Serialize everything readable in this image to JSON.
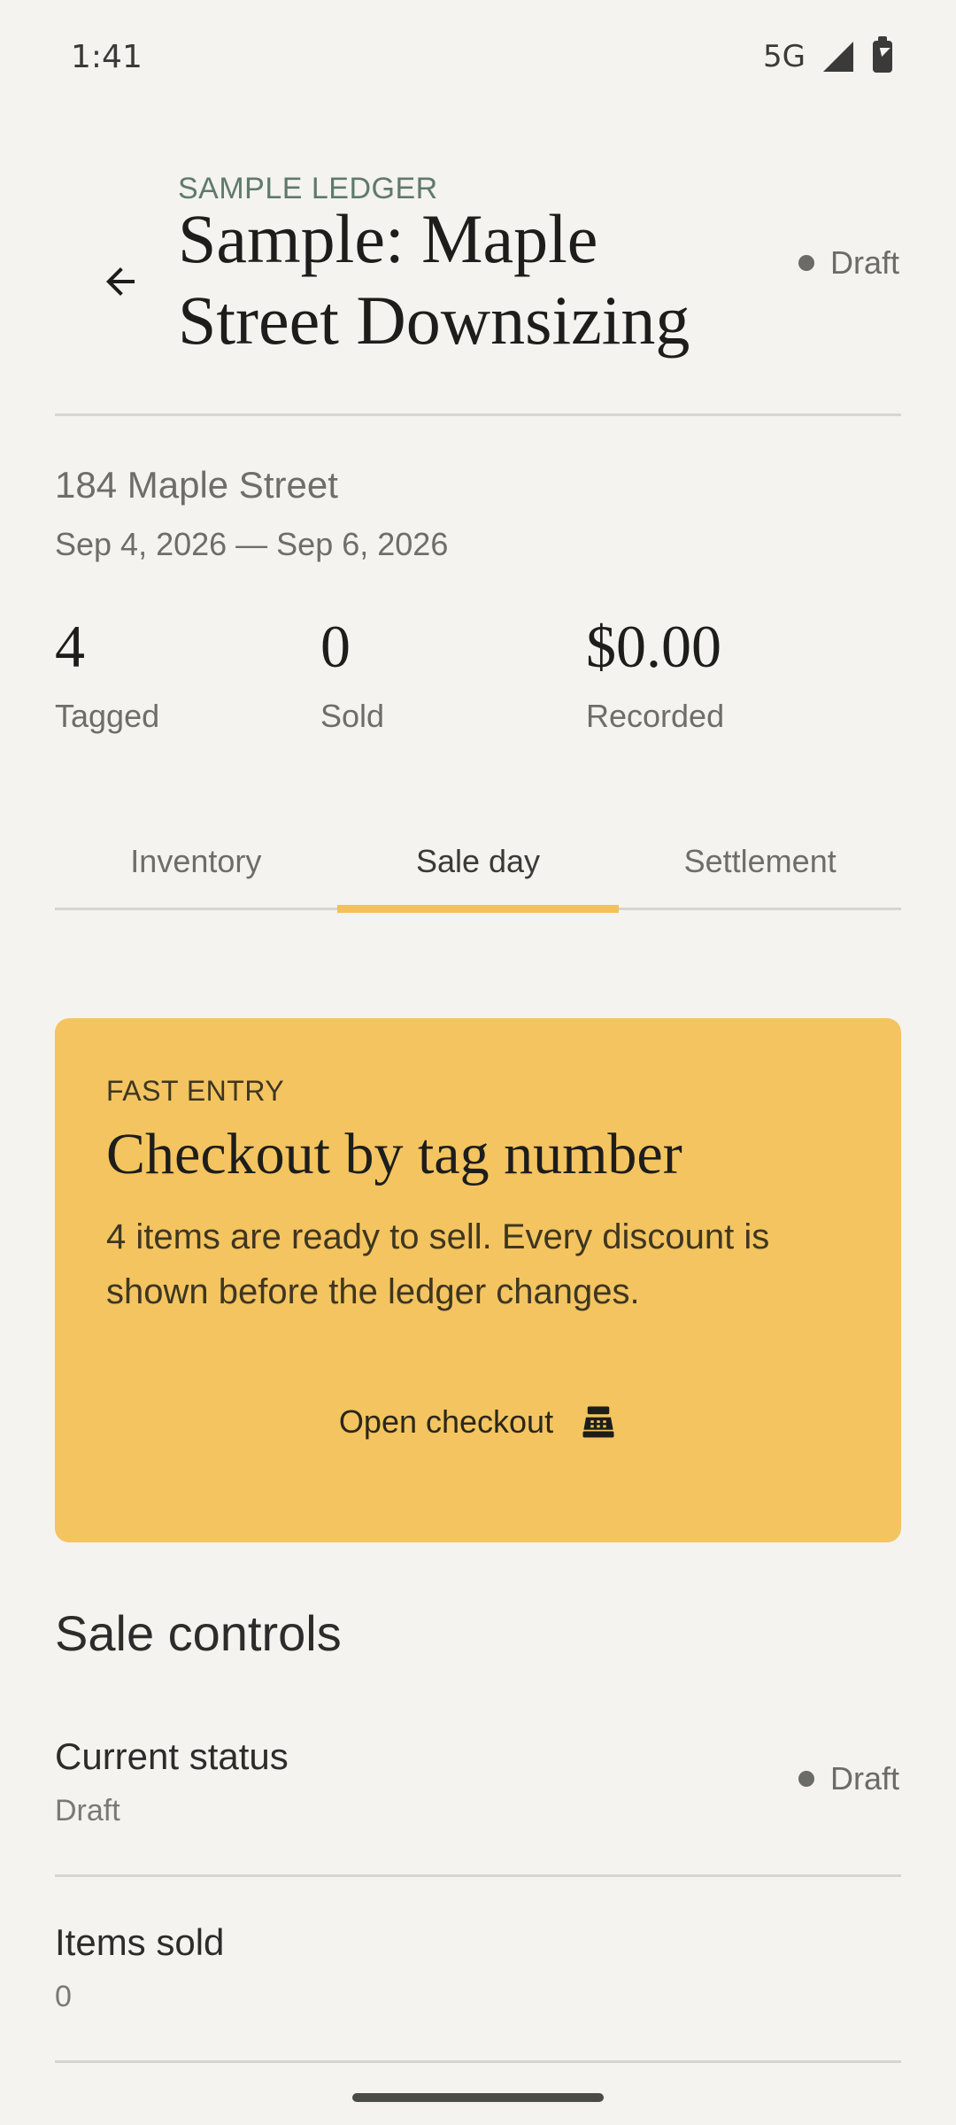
{
  "status_bar": {
    "time": "1:41",
    "network": "5G"
  },
  "header": {
    "kicker": "SAMPLE LEDGER",
    "title": "Sample: Maple Street Downsizing",
    "status": "Draft"
  },
  "sale": {
    "address": "184 Maple Street",
    "dates": "Sep 4, 2026 — Sep 6, 2026"
  },
  "stats": [
    {
      "value": "4",
      "label": "Tagged"
    },
    {
      "value": "0",
      "label": "Sold"
    },
    {
      "value": "$0.00",
      "label": "Recorded"
    }
  ],
  "tabs": [
    {
      "label": "Inventory",
      "active": false
    },
    {
      "label": "Sale day",
      "active": true
    },
    {
      "label": "Settlement",
      "active": false
    }
  ],
  "fast_entry": {
    "kicker": "FAST ENTRY",
    "title": "Checkout by tag number",
    "body": "4 items are ready to sell. Every discount is shown before the ledger changes.",
    "button_label": "Open checkout"
  },
  "sale_controls": {
    "title": "Sale controls",
    "rows": [
      {
        "label": "Current status",
        "value": "Draft",
        "badge": "Draft"
      },
      {
        "label": "Items sold",
        "value": "0"
      }
    ]
  },
  "colors": {
    "accent": "#f3c460",
    "background": "#f4f3ef",
    "kicker_green": "#5f7a6a"
  }
}
